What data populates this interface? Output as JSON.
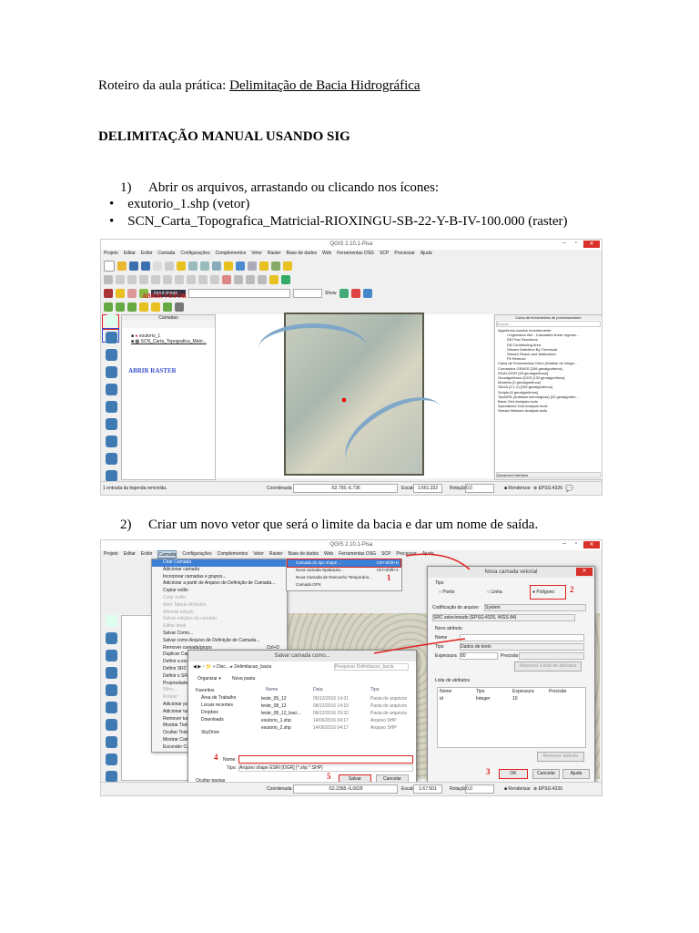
{
  "header": {
    "prefix": "Roteiro da aula prática: ",
    "title": "Delimitação de Bacia Hidrográfica"
  },
  "section_title": "DELIMITAÇÃO MANUAL USANDO SIG",
  "step1": {
    "number": "1)",
    "text": "Abrir os arquivos, arrastando ou clicando nos ícones:",
    "bullets": [
      "exutorio_1.shp (vetor)",
      "SCN_Carta_Topografica_Matricial-RIOXINGU-SB-22-Y-B-IV-100.000 (raster)"
    ]
  },
  "step2": {
    "number": "2)",
    "text": "Criar um novo vetor que será o limite da bacia e dar um nome de saída."
  },
  "qgis": {
    "window_title": "QGIS 2.10.1-Pisa",
    "menu": [
      "Projeto",
      "Editar",
      "Exibir",
      "Camada",
      "Configurações",
      "Complementos",
      "Vetor",
      "Raster",
      "Base de dados",
      "Web",
      "Ferramentas OSG",
      "SCP",
      "Processar",
      "Ajuda"
    ],
    "input_image": "Input image",
    "show_label": "Show",
    "layers_title": "Camadas",
    "layers": [
      "exutorio_1",
      "SCN_Carta_Topografica_Matri..."
    ],
    "annot_vetor": "ABRIR VETOR",
    "annot_raster": "ABRIR RASTER",
    "processing_title": "Caixa de ferramentas de processamento",
    "search_placeholder": "Buscar...",
    "processing_items": [
      "Algoritmos usados recentemente",
      "r.regression.line - Calculates linear regress...",
      "D8 Flow Directions",
      "D8 Contributing Area",
      "Stream Definition By Threshold",
      "Stream Reach and Watershed",
      "Pit Remove",
      "Caixa de Ferramentas Orfeo (Análise de image...",
      "Comandos GRASS [206 geoalgoritmos]",
      "GDAL/OGR [45 geoalgoritmos]",
      "Geoalgoritmos QGIS [133 geoalgoritmos]",
      "Modelos [0 geoalgoritmos]",
      "SAGA (2.1.2) [239 geoalgoritmos]",
      "Scripts [6 geoalgoritmos]",
      "TauDEM (Análises hidrológicas) [20 geoalgoritm...",
      "Basic Grid Analysis tools",
      "Specialized Grid Analysis tools",
      "Stream Network Analysis tools"
    ],
    "advanced_interface": "Advanced interface",
    "status_msg": "1 entrada da legenda removida.",
    "coord_label": "Coordenada",
    "coord1": "-52.755,-6.736",
    "coord2": "-52.2358,-6.0629",
    "scale_label": "Escala",
    "scale1": "1:561.332",
    "scale2": "1:67.501",
    "rotation_label": "Rotação",
    "rotation": "0,0",
    "render_label": "Renderizar",
    "crs": "EPSG:4326"
  },
  "camada_menu": {
    "items": [
      "Criar Camada",
      "Adicionar camada",
      "Incorporar camadas e grupos...",
      "Adicionar a partir de Arquivo de Definição de Camada...",
      "Copiar estilo",
      "Colar estilo",
      "Abrir Tabela Atributos",
      "Alternar edição",
      "Salvar edições da camada",
      "Editar atual",
      "Salvar Como...",
      "Salvar como Arquivo de Definição de Camada...",
      "Remover camada/grupo",
      "Duplicar Camada",
      "Definir a escala",
      "Definir SRC da",
      "Definir o SRC d",
      "Propriedades...",
      "Filtro...",
      "Rotular",
      "Adicionar para",
      "Adicionar tudo",
      "Remover tudo",
      "Mostrar Todas",
      "Ocultar Todas",
      "Mostrar Camad",
      "Esconder Camada"
    ],
    "remove_shortcut": "Ctrl+D",
    "submenu": [
      {
        "label": "Camada do tipo shape ...",
        "shortcut": "Ctrl+Shift+N"
      },
      {
        "label": "Nova camada SpatiaLite...",
        "shortcut": "Ctrl+Shift+A"
      },
      {
        "label": "Nova Camada de Rascunho Temporário...",
        "shortcut": ""
      },
      {
        "label": "Camada GPX",
        "shortcut": ""
      }
    ]
  },
  "save_dialog": {
    "title": "Salvar camada como...",
    "path": [
      "Disc...",
      "Delimitacao_bacia"
    ],
    "search": "Pesquisar Delimitacao_bacia",
    "organize": "Organizar ▾",
    "new_folder": "Nova pasta",
    "sidebar": [
      "Favoritos",
      "Área de Trabalho",
      "Locais recentes",
      "Dropbox",
      "Downloads",
      "SkyDrive"
    ],
    "columns": [
      "Nome",
      "Data",
      "Tipo"
    ],
    "files": [
      [
        "teste_05_12",
        "05/12/2016 14:31",
        "Pasta de arquivos"
      ],
      [
        "teste_08_12",
        "08/12/2016 14:15",
        "Pasta de arquivos"
      ],
      [
        "teste_08_12_baci...",
        "08/12/2016 15:32",
        "Pasta de arquivos"
      ],
      [
        "exutorio_1.shp",
        "14/06/2016 04:17",
        "Arquivo SHP"
      ],
      [
        "exutorio_2.shp",
        "14/06/2016 04:17",
        "Arquivo SHP"
      ]
    ],
    "name_label": "Nome:",
    "name_value": "",
    "type_label": "Tipo:",
    "type_value": "Arquivo shape ESRI [OGR] (*.shp *.SHP)",
    "hide_folders": "Ocultar pastas",
    "save": "Salvar",
    "cancel": "Cancelar"
  },
  "vector_dialog": {
    "title": "Nova camada vetorial",
    "type_label": "Tipo",
    "types": [
      "Ponto",
      "Linha",
      "Polígono"
    ],
    "encoding_label": "Codificação do arquivo",
    "encoding": "System",
    "crs": "SRC selecionado (EPSG:4326, WGS 84)",
    "new_attr": "Novo atributo",
    "name_label": "Nome",
    "type_field_label": "Tipo",
    "type_field": "Dados de texto",
    "width_label": "Espessura",
    "width": "80",
    "precision_label": "Precisão",
    "add_btn": "Adicionar à lista de atributos",
    "attr_list": "Lista de atributos",
    "columns": [
      "Nome",
      "Tipo",
      "Espessura",
      "Precisão"
    ],
    "attr_row": [
      "id",
      "Integer",
      "10",
      ""
    ],
    "remove_btn": "Remover atributo",
    "ok": "OK",
    "cancel": "Cancelar",
    "help": "Ajuda"
  },
  "step_markers": [
    "1",
    "2",
    "3",
    "4",
    "5"
  ],
  "accent": "#e02020"
}
